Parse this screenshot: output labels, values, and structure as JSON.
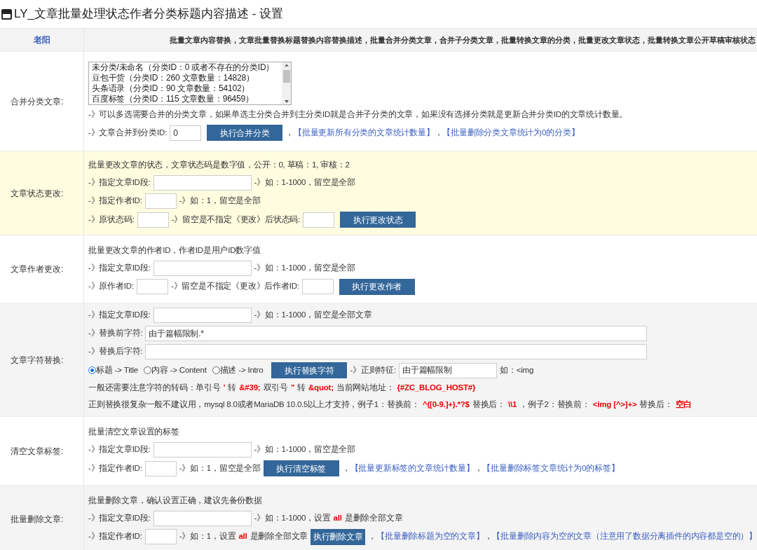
{
  "window": {
    "title": "LY_文章批量处理状态作者分类标题内容描述 - 设置"
  },
  "header": {
    "tab": "老阳",
    "description": "批量文章内容替换，文章批量替换标题替换内容替换描述，批量合并分类文章，合并子分类文章，批量转换文章的分类，批量更改文章状态，批量转换文章公开草稿审核状态"
  },
  "sections": [
    {
      "label": "合并分类文章:",
      "highlighted": false,
      "lines": [
        [
          {
            "kind": "listbox",
            "options": [
              "未分类/未命名（分类ID：0 或者不存在的分类ID）",
              "豆包干货（分类ID：260 文章数量：14828）",
              "头条语录（分类ID：90 文章数量：54102）",
              "百度标签（分类ID：115 文章数量：96459）"
            ]
          }
        ],
        [
          {
            "kind": "text",
            "text": "-》可以多选需要合并的分类文章，如果单选主分类合并到主分类ID就是合并子分类的文章，如果没有选择分类就是更新合并分类ID的文章统计数量。"
          }
        ],
        [
          {
            "kind": "text",
            "text": "-》文章合并到分类ID:"
          },
          {
            "kind": "input_short",
            "value": "0"
          },
          {
            "kind": "button",
            "text": "执行合并分类"
          },
          {
            "kind": "text",
            "text": "，"
          },
          {
            "kind": "link",
            "text": "【批量更新所有分类的文章统计数量】"
          },
          {
            "kind": "text",
            "text": "，"
          },
          {
            "kind": "link",
            "text": "【批量删除分类文章统计为0的分类】"
          }
        ]
      ]
    },
    {
      "label": "文章状态更改:",
      "highlighted": true,
      "lines": [
        [
          {
            "kind": "text",
            "text": "批量更改文章的状态，文章状态码是数字值，公开：0, 草稿：1, 审核：2"
          }
        ],
        [
          {
            "kind": "text",
            "text": "-》指定文章ID段:"
          },
          {
            "kind": "input_mid"
          },
          {
            "kind": "text",
            "text": "-》如：1-1000，留空是全部"
          }
        ],
        [
          {
            "kind": "text",
            "text": "-》指定作者ID:"
          },
          {
            "kind": "input_short"
          },
          {
            "kind": "text",
            "text": "-》如：1，留空是全部"
          }
        ],
        [
          {
            "kind": "text",
            "text": "-》原状态码:"
          },
          {
            "kind": "input_short"
          },
          {
            "kind": "text",
            "text": "-》留空是不指定《更改》后状态码:"
          },
          {
            "kind": "input_short"
          },
          {
            "kind": "button",
            "text": "执行更改状态"
          }
        ]
      ]
    },
    {
      "label": "文章作者更改:",
      "highlighted": false,
      "lines": [
        [
          {
            "kind": "text",
            "text": "批量更改文章的作者ID，作者ID是用户ID数字值"
          }
        ],
        [
          {
            "kind": "text",
            "text": "-》指定文章ID段:"
          },
          {
            "kind": "input_mid"
          },
          {
            "kind": "text",
            "text": "-》如：1-1000，留空是全部"
          }
        ],
        [
          {
            "kind": "text",
            "text": "-》原作者ID:"
          },
          {
            "kind": "input_short"
          },
          {
            "kind": "text",
            "text": "-》留空是不指定《更改》后作者ID:"
          },
          {
            "kind": "input_short"
          },
          {
            "kind": "button",
            "text": "执行更改作者"
          }
        ]
      ]
    },
    {
      "label": "文章字符替换:",
      "highlighted": false,
      "lines": [
        [
          {
            "kind": "text",
            "text": "-》指定文章ID段:"
          },
          {
            "kind": "input_mid"
          },
          {
            "kind": "text",
            "text": "-》如：1-1000，留空是全部文章"
          }
        ],
        [
          {
            "kind": "text",
            "text": "-》替换前字符:"
          },
          {
            "kind": "input_full",
            "value": "由于篇幅限制.*"
          }
        ],
        [
          {
            "kind": "text",
            "text": "-》替换后字符:"
          },
          {
            "kind": "input_full"
          }
        ],
        [
          {
            "kind": "radio",
            "text": "标题 -> Title",
            "selected": true
          },
          {
            "kind": "radio",
            "text": "内容 -> Content",
            "selected": false
          },
          {
            "kind": "radio",
            "text": "描述 -> Intro",
            "selected": false
          },
          {
            "kind": "button",
            "text": "执行替换字符"
          },
          {
            "kind": "text",
            "text": "-》正则特征:"
          },
          {
            "kind": "input_mid",
            "value": "由于篇幅限制"
          },
          {
            "kind": "text",
            "text": "如：<img"
          }
        ],
        [
          {
            "kind": "text",
            "text": "一般还需要注意字符的转码：单引号"
          },
          {
            "kind": "em",
            "text": "'"
          },
          {
            "kind": "text",
            "text": "转"
          },
          {
            "kind": "em",
            "text": "&#39;"
          },
          {
            "kind": "text",
            "text": "双引号"
          },
          {
            "kind": "em",
            "text": "\""
          },
          {
            "kind": "text",
            "text": "转"
          },
          {
            "kind": "em",
            "text": "&quot;"
          },
          {
            "kind": "text",
            "text": "当前网站地址："
          },
          {
            "kind": "em",
            "text": "{#ZC_BLOG_HOST#}"
          }
        ],
        [
          {
            "kind": "text",
            "text": "正则替换很复杂一般不建议用，mysql 8.0或者MariaDB 10.0.5以上才支持，例子1：替换前："
          },
          {
            "kind": "em",
            "text": "^([0-9.]+).*?$"
          },
          {
            "kind": "text",
            "text": "替换后："
          },
          {
            "kind": "em",
            "text": "\\\\1"
          },
          {
            "kind": "text",
            "text": "，例子2：替换前："
          },
          {
            "kind": "em",
            "text": "<img [^>]+>"
          },
          {
            "kind": "text",
            "text": "替换后："
          },
          {
            "kind": "em",
            "text": "空白"
          }
        ]
      ]
    },
    {
      "label": "清空文章标签:",
      "highlighted": false,
      "lines": [
        [
          {
            "kind": "text",
            "text": "批量清空文章设置的标签"
          }
        ],
        [
          {
            "kind": "text",
            "text": "-》指定文章ID段:"
          },
          {
            "kind": "input_mid"
          },
          {
            "kind": "text",
            "text": "-》如：1-1000，留空是全部"
          }
        ],
        [
          {
            "kind": "text",
            "text": "-》指定作者ID:"
          },
          {
            "kind": "input_short"
          },
          {
            "kind": "text",
            "text": "-》如：1，留空是全部"
          },
          {
            "kind": "button",
            "text": "执行清空标签"
          },
          {
            "kind": "text",
            "text": "，"
          },
          {
            "kind": "link",
            "text": "【批量更新标签的文章统计数量】"
          },
          {
            "kind": "text",
            "text": "，"
          },
          {
            "kind": "link",
            "text": "【批量删除标签文章统计为0的标签】"
          }
        ]
      ]
    },
    {
      "label": "批量删除文章:",
      "highlighted": false,
      "lines": [
        [
          {
            "kind": "text",
            "text": "批量删除文章，确认设置正确，建议先备份数据"
          }
        ],
        [
          {
            "kind": "text",
            "text": "-》指定文章ID段:"
          },
          {
            "kind": "input_mid"
          },
          {
            "kind": "text",
            "text": "-》如：1-1000，设置"
          },
          {
            "kind": "em",
            "text": "all"
          },
          {
            "kind": "text",
            "text": "是删除全部文章"
          }
        ],
        [
          {
            "kind": "text",
            "text": "-》指定作者ID:"
          },
          {
            "kind": "input_short"
          },
          {
            "kind": "text",
            "text": "-》如：1，设置"
          },
          {
            "kind": "em",
            "text": "all"
          },
          {
            "kind": "text",
            "text": "是删除全部文章"
          },
          {
            "kind": "button",
            "text": "执行删除文章"
          },
          {
            "kind": "text",
            "text": "，"
          },
          {
            "kind": "link",
            "text": "【批量删除标题为空的文章】"
          },
          {
            "kind": "text",
            "text": "，"
          },
          {
            "kind": "link",
            "text": "【批量删除内容为空的文章（注意用了数据分离插件的内容都是空的）】"
          }
        ]
      ]
    }
  ]
}
